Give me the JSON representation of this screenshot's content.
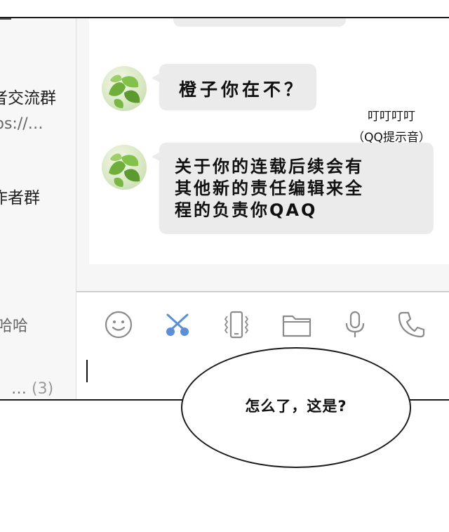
{
  "sidebar": {
    "items": [
      {
        "name": "者交流群",
        "preview": "ps://…"
      },
      {
        "name": "作者群",
        "preview": ""
      },
      {
        "name": "",
        "preview": "哈哈"
      },
      {
        "name": "",
        "preview": "…",
        "count": "(3)"
      }
    ]
  },
  "chat": {
    "messages": [
      {
        "sender": "contact",
        "lines": [
          "橙子你在不？"
        ]
      },
      {
        "sender": "contact",
        "lines": [
          "关于你的连载后续会有",
          "其他新的责任编辑来全",
          "程的负责你QAQ"
        ]
      }
    ],
    "sound_effect": {
      "line1": "叮叮叮叮",
      "line2": "（QQ提示音）"
    }
  },
  "toolbar": {
    "icons": [
      "emoji-icon",
      "scissors-icon",
      "shake-icon",
      "folder-icon",
      "microphone-icon",
      "phone-icon"
    ]
  },
  "input": {
    "value": ""
  },
  "balloon": {
    "text": "怎么了，这是?"
  },
  "colors": {
    "bubble": "#ebebeb",
    "accent": "#5b8fd6",
    "icon": "#8a8a8a",
    "ink": "#111111"
  }
}
